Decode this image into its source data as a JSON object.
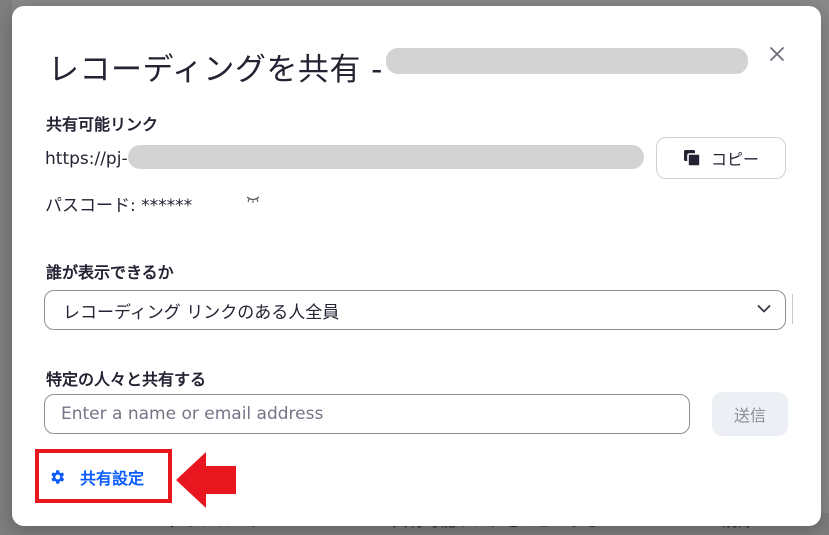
{
  "background": {
    "bottom_items": [
      "ダウンロード",
      "共有可能リンクをコピーする",
      "削除"
    ]
  },
  "dialog": {
    "title": "レコーディングを共有 -",
    "close_icon": "close-icon",
    "share_link": {
      "label": "共有可能リンク",
      "url_prefix": "https://pj-",
      "copy_label": "コピー",
      "copy_icon": "copy-icon"
    },
    "passcode": {
      "text": "パスコード: ******",
      "icon": "eye-closed-icon"
    },
    "who_can_view": {
      "label": "誰が表示できるか",
      "selected": "レコーディング リンクのある人全員"
    },
    "share_with": {
      "label": "特定の人々と共有する",
      "placeholder": "Enter a name or email address",
      "send_label": "送信"
    },
    "settings": {
      "label": "共有設定",
      "icon": "gear-icon"
    }
  },
  "colors": {
    "accent": "#0b5cff",
    "annotation": "#e8161e",
    "text": "#232333"
  }
}
